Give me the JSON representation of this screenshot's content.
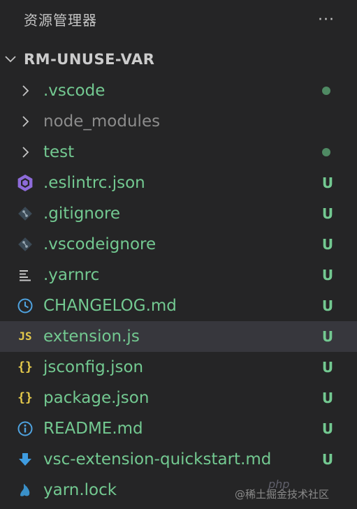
{
  "panel": {
    "title": "资源管理器",
    "more_label": "···"
  },
  "root": {
    "label": "RM-UNUSE-VAR",
    "expanded": true
  },
  "colors": {
    "background": "#252526",
    "selected_row": "#37373d",
    "untracked_text": "#73c991",
    "ignored_text": "#8c8c8c",
    "status_dot": "#4f8a63",
    "status_u": "#73c991"
  },
  "items": [
    {
      "label": ".vscode",
      "kind": "folder",
      "icon": "chevron-right-icon",
      "status": "dot",
      "color": "#73c991"
    },
    {
      "label": "node_modules",
      "kind": "folder",
      "icon": "chevron-right-icon",
      "status": "",
      "color": "#8c8c8c"
    },
    {
      "label": "test",
      "kind": "folder",
      "icon": "chevron-right-icon",
      "status": "dot",
      "color": "#73c991"
    },
    {
      "label": ".eslintrc.json",
      "kind": "file",
      "icon": "eslint-icon",
      "status": "U",
      "color": "#73c991"
    },
    {
      "label": ".gitignore",
      "kind": "file",
      "icon": "git-icon",
      "status": "U",
      "color": "#73c991"
    },
    {
      "label": ".vscodeignore",
      "kind": "file",
      "icon": "git-icon",
      "status": "U",
      "color": "#73c991"
    },
    {
      "label": ".yarnrc",
      "kind": "file",
      "icon": "lines-icon",
      "status": "U",
      "color": "#73c991"
    },
    {
      "label": "CHANGELOG.md",
      "kind": "file",
      "icon": "clock-icon",
      "status": "U",
      "color": "#73c991"
    },
    {
      "label": "extension.js",
      "kind": "file",
      "icon": "js-icon",
      "status": "U",
      "color": "#73c991",
      "selected": true
    },
    {
      "label": "jsconfig.json",
      "kind": "file",
      "icon": "json-icon",
      "status": "U",
      "color": "#73c991"
    },
    {
      "label": "package.json",
      "kind": "file",
      "icon": "json-icon",
      "status": "U",
      "color": "#73c991"
    },
    {
      "label": "README.md",
      "kind": "file",
      "icon": "info-icon",
      "status": "U",
      "color": "#73c991"
    },
    {
      "label": "vsc-extension-quickstart.md",
      "kind": "file",
      "icon": "download-icon",
      "status": "U",
      "color": "#73c991"
    },
    {
      "label": "yarn.lock",
      "kind": "file",
      "icon": "yarn-icon",
      "status": "",
      "color": "#73c991"
    }
  ],
  "watermark": {
    "brand": "php",
    "text": "@稀土掘金技术社区"
  }
}
